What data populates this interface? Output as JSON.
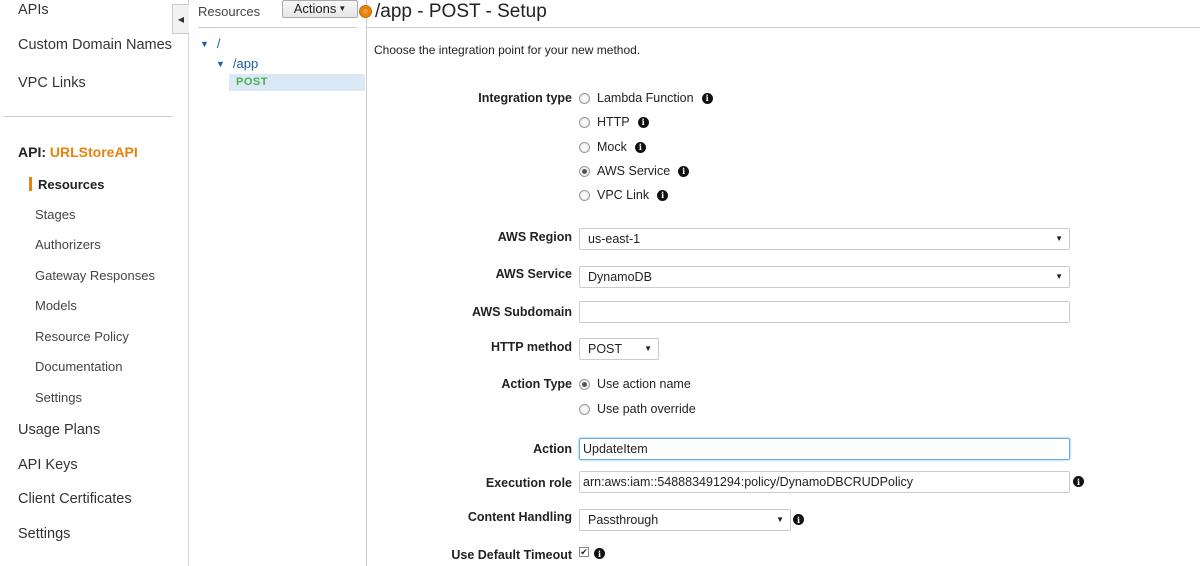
{
  "left_nav": {
    "top_items": [
      "APIs",
      "Custom Domain Names",
      "VPC Links"
    ],
    "api_prefix": "API:",
    "api_name": "URLStoreAPI",
    "api_items": [
      "Resources",
      "Stages",
      "Authorizers",
      "Gateway Responses",
      "Models",
      "Resource Policy",
      "Documentation",
      "Settings"
    ],
    "bottom_items": [
      "Usage Plans",
      "API Keys",
      "Client Certificates",
      "Settings"
    ],
    "collapse_icon": "caret-left-icon"
  },
  "tree": {
    "header_label": "Resources",
    "actions_label": "Actions",
    "root": "/",
    "child": "/app",
    "method": "POST"
  },
  "main": {
    "title": "/app - POST - Setup",
    "subtitle": "Choose the integration point for your new method.",
    "integration_type": {
      "label": "Integration type",
      "options": [
        "Lambda Function",
        "HTTP",
        "Mock",
        "AWS Service",
        "VPC Link"
      ],
      "selected": "AWS Service"
    },
    "aws_region": {
      "label": "AWS Region",
      "value": "us-east-1"
    },
    "aws_service": {
      "label": "AWS Service",
      "value": "DynamoDB"
    },
    "aws_subdomain": {
      "label": "AWS Subdomain",
      "value": ""
    },
    "http_method": {
      "label": "HTTP method",
      "value": "POST"
    },
    "action_type": {
      "label": "Action Type",
      "options": [
        "Use action name",
        "Use path override"
      ],
      "selected": "Use action name"
    },
    "action": {
      "label": "Action",
      "value": "UpdateItem"
    },
    "execution_role": {
      "label": "Execution role",
      "value": "arn:aws:iam::548883491294:policy/DynamoDBCRUDPolicy"
    },
    "content_handling": {
      "label": "Content Handling",
      "value": "Passthrough"
    },
    "default_timeout": {
      "label": "Use Default Timeout",
      "checked": true
    }
  },
  "colors": {
    "accent": "#e8820c",
    "link": "#1a5fa8",
    "method": "#4caf50",
    "selected_row": "#dbe9f7"
  }
}
